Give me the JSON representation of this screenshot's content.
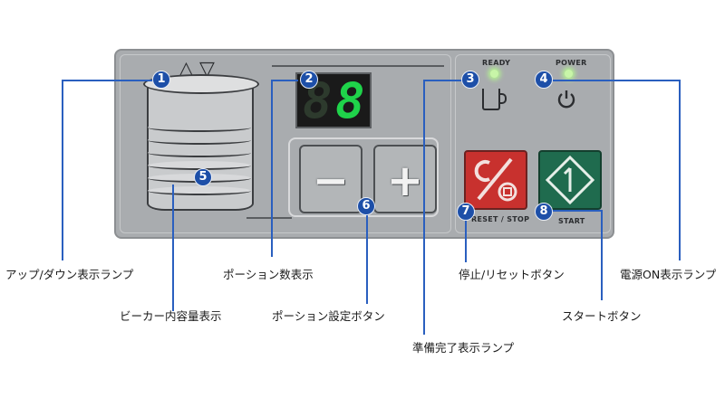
{
  "panel": {
    "display": {
      "digit_dim": "8",
      "digit_value": "8"
    },
    "indicators": {
      "ready_label": "READY",
      "power_label": "POWER"
    },
    "buttons": {
      "minus_glyph": "−",
      "plus_glyph": "+",
      "reset_label": "RESET / STOP",
      "start_label": "START"
    },
    "arrows": {
      "up": "△",
      "down": "▽"
    }
  },
  "markers": [
    "1",
    "2",
    "3",
    "4",
    "5",
    "6",
    "7",
    "8"
  ],
  "captions": {
    "updown_lamp": "アップ/ダウン表示ランプ",
    "beaker_level": "ビーカー内容量表示",
    "portion_count": "ポーション数表示",
    "portion_set_button": "ポーション設定ボタン",
    "ready_lamp": "準備完了表示ランプ",
    "stop_reset_button": "停止/リセットボタン",
    "start_button": "スタートボタン",
    "power_lamp": "電源ON表示ランプ"
  },
  "colors": {
    "panel": "#a9acaf",
    "marker": "#1d4fa8",
    "lead_line": "#2a5fbf",
    "display_on": "#1fd34a",
    "reset_button": "#c8312e",
    "start_button": "#1f6b4e",
    "led": "#b6ff8c"
  },
  "icons": [
    "triangle-up-icon",
    "triangle-down-icon",
    "cup-icon",
    "power-icon",
    "reset-stop-icon",
    "start-diamond-icon"
  ]
}
